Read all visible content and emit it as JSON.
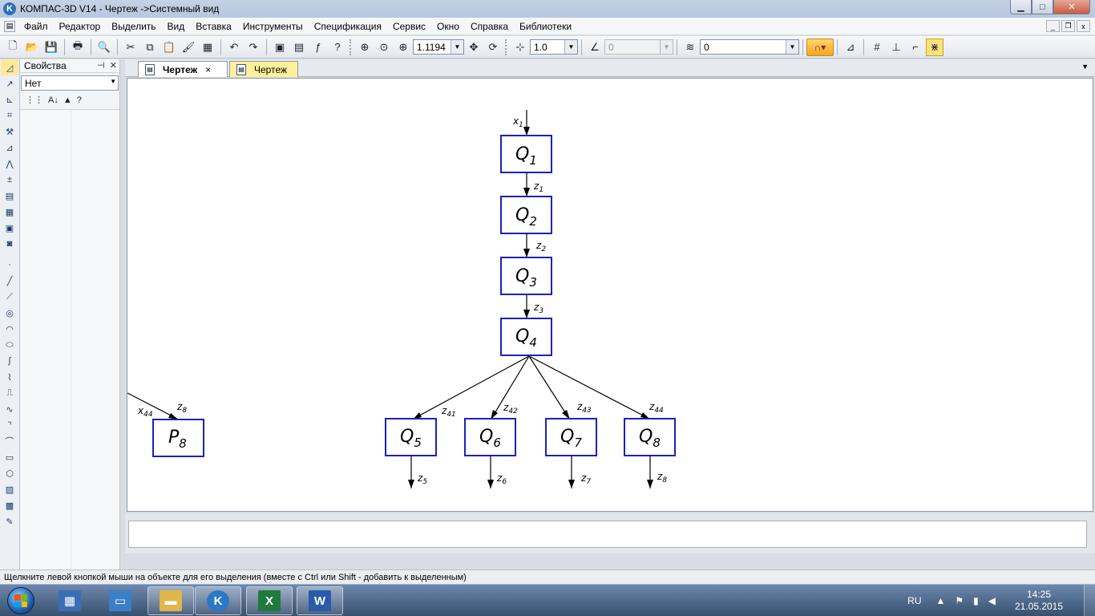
{
  "window": {
    "title": "КОМПАС-3D V14 - Чертеж ->Системный вид",
    "logo_text": "K",
    "controls": {
      "minimize": "▁",
      "maximize": "□",
      "close": "✕"
    }
  },
  "menu": {
    "items": [
      "Файл",
      "Редактор",
      "Выделить",
      "Вид",
      "Вставка",
      "Инструменты",
      "Спецификация",
      "Сервис",
      "Окно",
      "Справка",
      "Библиотеки"
    ],
    "doc_controls": {
      "minimize": "_",
      "restore": "❐",
      "close": "x"
    }
  },
  "toolbar": {
    "zoom_value": "1.1194",
    "step_value": "1.0",
    "angle_value": "0",
    "layer_value": "0"
  },
  "properties_panel": {
    "title": "Свойства",
    "pin": "⊣",
    "close": "✕",
    "filter_value": "Нет"
  },
  "tabs": [
    {
      "label": "Чертеж",
      "close": "×"
    },
    {
      "label": "Чертеж"
    }
  ],
  "diagram": {
    "input_top": {
      "main": "x",
      "sub": "1"
    },
    "input_left": {
      "main": "x",
      "sub": "44"
    },
    "chain": [
      {
        "main": "Q",
        "sub": "1"
      },
      {
        "main": "Q",
        "sub": "2"
      },
      {
        "main": "Q",
        "sub": "3"
      },
      {
        "main": "Q",
        "sub": "4"
      }
    ],
    "chain_links": [
      {
        "main": "z",
        "sub": "1"
      },
      {
        "main": "z",
        "sub": "2"
      },
      {
        "main": "z",
        "sub": "3"
      }
    ],
    "fan_links": [
      {
        "main": "z",
        "sub": "41"
      },
      {
        "main": "z",
        "sub": "42"
      },
      {
        "main": "z",
        "sub": "43"
      },
      {
        "main": "z",
        "sub": "44"
      }
    ],
    "bottom_blocks": [
      {
        "main": "Q",
        "sub": "5"
      },
      {
        "main": "Q",
        "sub": "6"
      },
      {
        "main": "Q",
        "sub": "7"
      },
      {
        "main": "Q",
        "sub": "8"
      }
    ],
    "outputs": [
      {
        "main": "z",
        "sub": "5"
      },
      {
        "main": "z",
        "sub": "6"
      },
      {
        "main": "z",
        "sub": "7"
      },
      {
        "main": "z",
        "sub": "8"
      }
    ],
    "p_block": {
      "main": "P",
      "sub": "8"
    },
    "p_input_label": {
      "main": "z",
      "sub": "8"
    }
  },
  "status": {
    "hint": "Щелкните левой кнопкой мыши на объекте для его выделения (вместе с Ctrl или Shift - добавить к выделенным)"
  },
  "taskbar": {
    "apps": [
      {
        "name": "calculator",
        "color": "#3a6fb5"
      },
      {
        "name": "remote-desktop",
        "color": "#3b7fc9"
      },
      {
        "name": "explorer",
        "color": "#e0b54a"
      },
      {
        "name": "kompas",
        "color": "#2a78c8"
      },
      {
        "name": "excel",
        "color": "#1f7a3c",
        "glyph": "X"
      },
      {
        "name": "word",
        "color": "#2b5aa8",
        "glyph": "W"
      }
    ],
    "language": "RU",
    "time": "14:25",
    "date": "21.05.2015"
  }
}
